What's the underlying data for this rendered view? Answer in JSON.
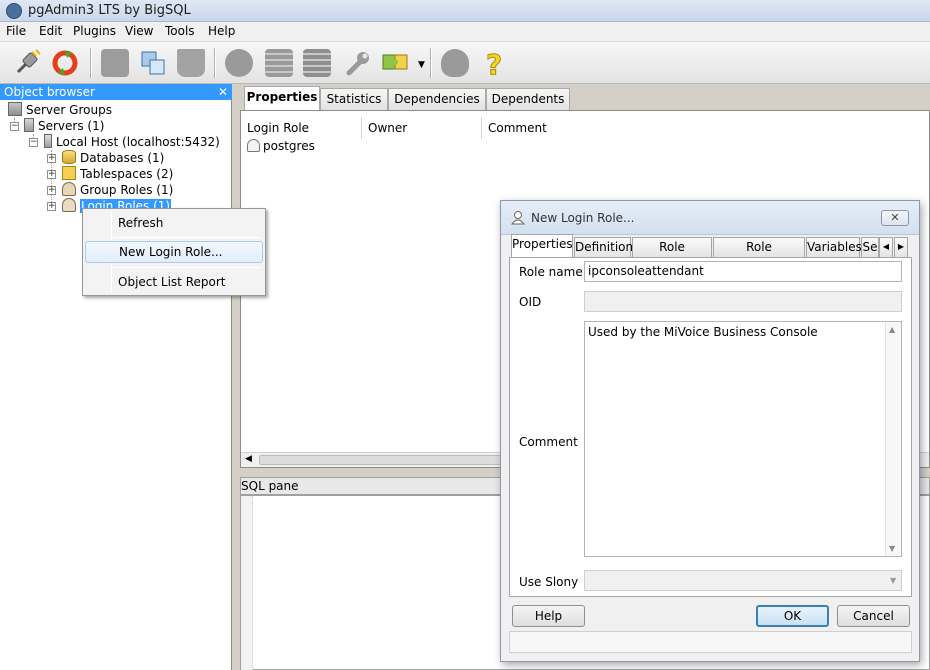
{
  "window": {
    "title": "pgAdmin3 LTS by BigSQL"
  },
  "menu": [
    "File",
    "Edit",
    "Plugins",
    "View",
    "Tools",
    "Help"
  ],
  "toolbar": {
    "icons": [
      "connect-plug-icon",
      "refresh-icon",
      "properties-icon",
      "create-object-icon",
      "drop-object-icon",
      "sql-query-icon",
      "view-data-icon",
      "filtered-data-icon",
      "maintenance-wrench-icon",
      "plugins-puzzle-icon",
      "tips-icon",
      "help-icon"
    ]
  },
  "object_browser": {
    "title": "Object browser",
    "close": "✕",
    "tree": [
      {
        "label": "Server Groups",
        "icon": "server-group-icon"
      },
      {
        "label": "Servers (1)",
        "icon": "servers-icon"
      },
      {
        "label": "Local Host (localhost:5432)",
        "icon": "server-icon"
      },
      {
        "label": "Databases (1)",
        "icon": "database-icon"
      },
      {
        "label": "Tablespaces (2)",
        "icon": "tablespace-icon"
      },
      {
        "label": "Group Roles (1)",
        "icon": "group-roles-icon"
      },
      {
        "label": "Login Roles (1)",
        "icon": "login-roles-icon"
      }
    ]
  },
  "context_menu": {
    "items": [
      "Refresh",
      "New Login Role...",
      "Object List Report"
    ]
  },
  "properties_pane": {
    "tabs": [
      "Properties",
      "Statistics",
      "Dependencies",
      "Dependents"
    ],
    "columns": [
      "Login Role",
      "Owner",
      "Comment"
    ],
    "rows": [
      {
        "login_role": "postgres",
        "owner": "",
        "comment": ""
      }
    ]
  },
  "sql_pane": {
    "title": "SQL pane"
  },
  "dialog": {
    "title": "New Login Role...",
    "close": "✕",
    "tabs": [
      "Properties",
      "Definition",
      "Role privileges",
      "Role membership",
      "Variables",
      "Se"
    ],
    "fields": {
      "role_name_label": "Role name",
      "role_name_value": "ipconsoleattendant",
      "oid_label": "OID",
      "oid_value": "",
      "comment_label": "Comment",
      "comment_value": "Used by the MiVoice Business Console",
      "use_slony_label": "Use Slony",
      "use_slony_value": ""
    },
    "buttons": {
      "help": "Help",
      "ok": "OK",
      "cancel": "Cancel"
    }
  }
}
